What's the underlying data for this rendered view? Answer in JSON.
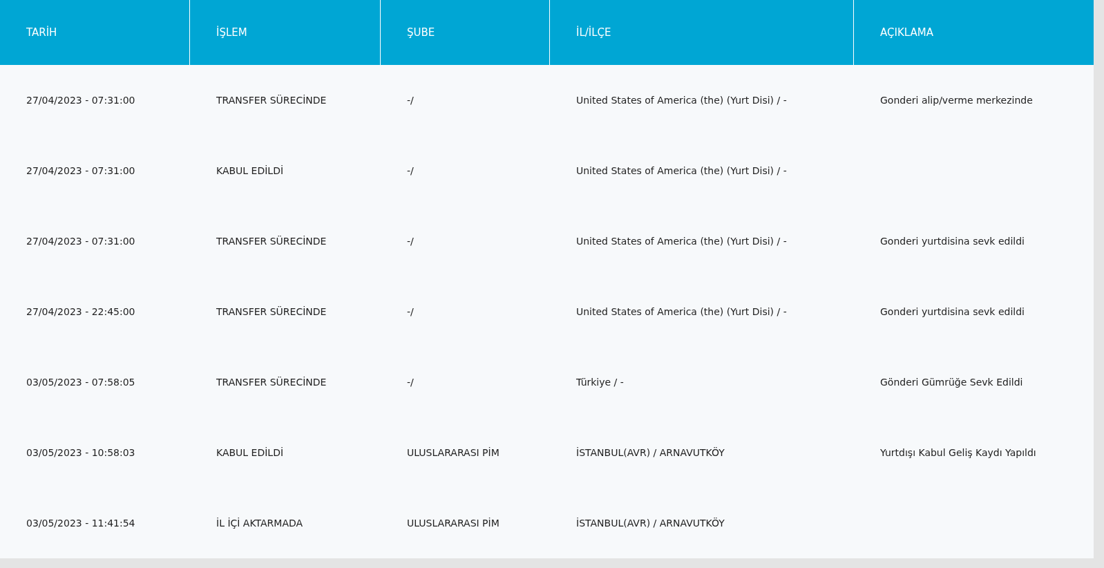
{
  "table": {
    "columns": [
      "TARİH",
      "İŞLEM",
      "ŞUBE",
      "İL/İLÇE",
      "AÇIKLAMA"
    ],
    "rows": [
      [
        "27/04/2023 - 07:31:00",
        "TRANSFER SÜRECİNDE",
        "-/",
        "United States of America (the) (Yurt Disi) / -",
        "Gonderi alip/verme merkezinde"
      ],
      [
        "27/04/2023 - 07:31:00",
        "KABUL EDİLDİ",
        "-/",
        "United States of America (the) (Yurt Disi) / -",
        ""
      ],
      [
        "27/04/2023 - 07:31:00",
        "TRANSFER SÜRECİNDE",
        "-/",
        "United States of America (the) (Yurt Disi) / -",
        "Gonderi yurtdisina sevk edildi"
      ],
      [
        "27/04/2023 - 22:45:00",
        "TRANSFER SÜRECİNDE",
        "-/",
        "United States of America (the) (Yurt Disi) / -",
        "Gonderi yurtdisina sevk edildi"
      ],
      [
        "03/05/2023 - 07:58:05",
        "TRANSFER SÜRECİNDE",
        "-/",
        "Türkiye / -",
        "Gönderi Gümrüğe Sevk Edildi"
      ],
      [
        "03/05/2023 - 10:58:03",
        "KABUL EDİLDİ",
        "ULUSLARARASI PİM",
        "İSTANBUL(AVR) / ARNAVUTKÖY",
        "Yurtdışı Kabul Geliş Kaydı Yapıldı"
      ],
      [
        "03/05/2023 - 11:41:54",
        "İL İÇİ AKTARMADA",
        "ULUSLARARASI PİM",
        "İSTANBUL(AVR) / ARNAVUTKÖY",
        ""
      ]
    ]
  }
}
